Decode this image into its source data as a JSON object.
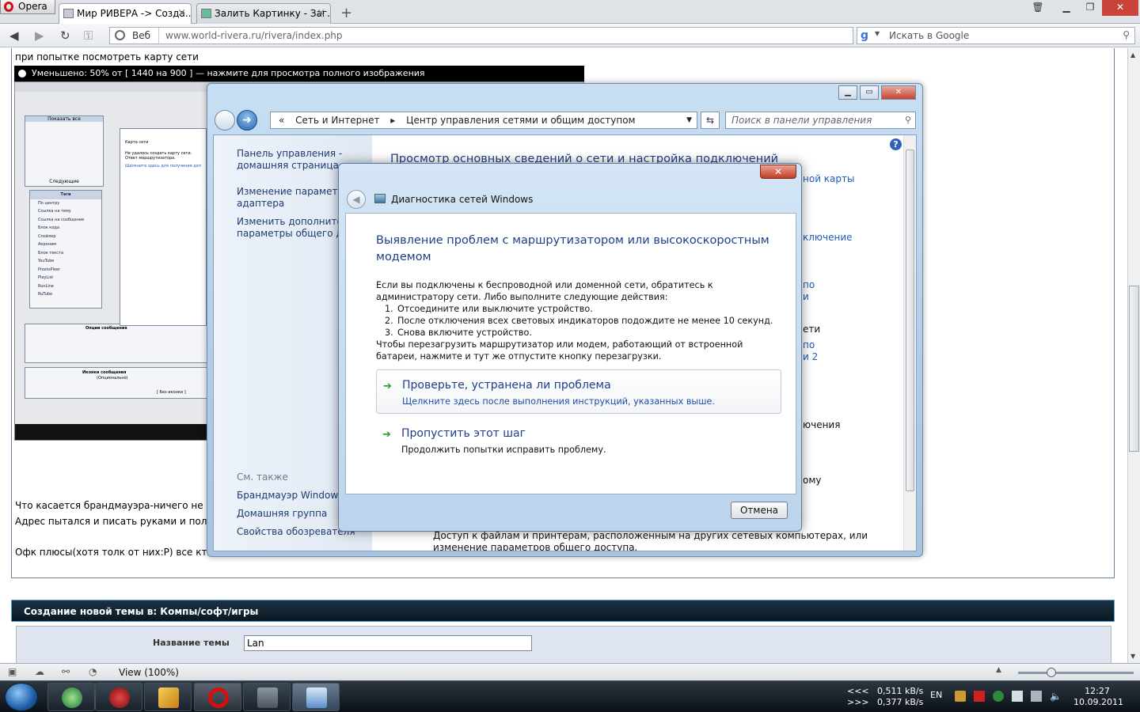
{
  "browser": {
    "menu_label": "Opera",
    "tabs": [
      {
        "label": "Мир РИВЕРА -> Созда...",
        "active": true
      },
      {
        "label": "Залить Картинку - Заг...",
        "active": false
      }
    ],
    "new_tab": "+",
    "address_mode": "Веб",
    "url": "www.world-rivera.ru/rivera/index.php",
    "search_placeholder": "Искать в Google",
    "zoom_label": "View (100%)"
  },
  "post": {
    "caption_top": "при попытке посмотреть карту сети",
    "thumbnail_caption": "Уменьшено: 50% от [ 1440 на 900 ] — нажмите для просмотра полного изображения",
    "line1": "Что касается брандмауэра-ничего не",
    "line2": "Адрес пытался и писать руками и пол",
    "line3": "Офк плюсы(хотя толк от них:Р) все кт",
    "thumb_tags_title": "Теги",
    "thumb_tags": [
      "По центру",
      "Ссылка на тему",
      "Ссылка на сообщение",
      "Блок кода",
      "Спойлер",
      "Акроним",
      "Блок текста",
      "YouTube",
      "ProstoPleer",
      "PlayList",
      "RunLine",
      "RuTube"
    ],
    "thumb_show_all": "Показать все",
    "thumb_next": "Следующие",
    "thumb_options": "Опции сообщения",
    "thumb_icons": "Иконки сообщения",
    "thumb_icons_opt": "(Опционально)",
    "thumb_no_icon": "[ Без иконки ]",
    "thumb_map_tab": "Карта сети",
    "thumb_map_error": "Не удалось создать карту сети. Ответ маршрутизатора.",
    "thumb_map_link": "Щелкните здесь для получения доп"
  },
  "form": {
    "header": "Создание новой темы в: Компы/софт/игры",
    "topic_label": "Название темы",
    "topic_value": "Lan"
  },
  "control_panel": {
    "breadcrumb": [
      "Сеть и Интернет",
      "Центр управления сетями и общим доступом"
    ],
    "search_placeholder": "Поиск в панели управления",
    "left_links": [
      {
        "l1": "Панель управления -",
        "l2": "домашняя страница"
      },
      {
        "l1": "Изменение параметров",
        "l2": "адаптера"
      },
      {
        "l1": "Изменить дополнитель",
        "l2": "параметры общего дос"
      }
    ],
    "see_also": "См. также",
    "see_also_links": [
      "Брандмауэр Windows",
      "Домашняя группа",
      "Свойства обозревателя"
    ],
    "title": "Просмотр основных сведений о сети и настройка подключений",
    "right_fragments": {
      "a": "ной карты",
      "b": "ключение",
      "c": "по",
      "d": "и",
      "e": "ети",
      "f": "по",
      "g": "и 2",
      "h": "ючения",
      "i": "ому"
    },
    "bottom_text1": "Доступ к файлам и принтерам, расположенным на других сетевых компьютерах, или",
    "bottom_text2": "изменение параметров общего доступа."
  },
  "dialog": {
    "caption": "Диагностика сетей Windows",
    "heading": "Выявление проблем с маршрутизатором или высокоскоростным модемом",
    "intro": "Если вы подключены к беспроводной или доменной сети, обратитесь к администратору сети. Либо выполните следующие действия:",
    "steps": [
      "Отсоедините или выключите устройство.",
      "После отключения всех световых индикаторов подождите не менее 10 секунд.",
      "Снова включите устройство."
    ],
    "outro": "Чтобы перезагрузить маршрутизатор или модем, работающий от встроенной батареи, нажмите и тут же отпустите кнопку перезагрузки.",
    "option1_title": "Проверьте, устранена ли проблема",
    "option1_desc": "Щелкните здесь после выполнения инструкций, указанных выше.",
    "option2_title": "Пропустить этот шаг",
    "option2_desc": "Продолжить попытки исправить проблему.",
    "cancel": "Отмена"
  },
  "taskbar": {
    "speed_up_label": "<<<",
    "speed_up": "0,511 kB/s",
    "speed_down_label": ">>>",
    "speed_down": "0,377 kB/s",
    "lang": "EN",
    "time": "12:27",
    "date": "10.09.2011"
  },
  "colors": {
    "link": "#1e5ab8",
    "heading": "#1e3e88",
    "form_header": "#0a1722"
  }
}
